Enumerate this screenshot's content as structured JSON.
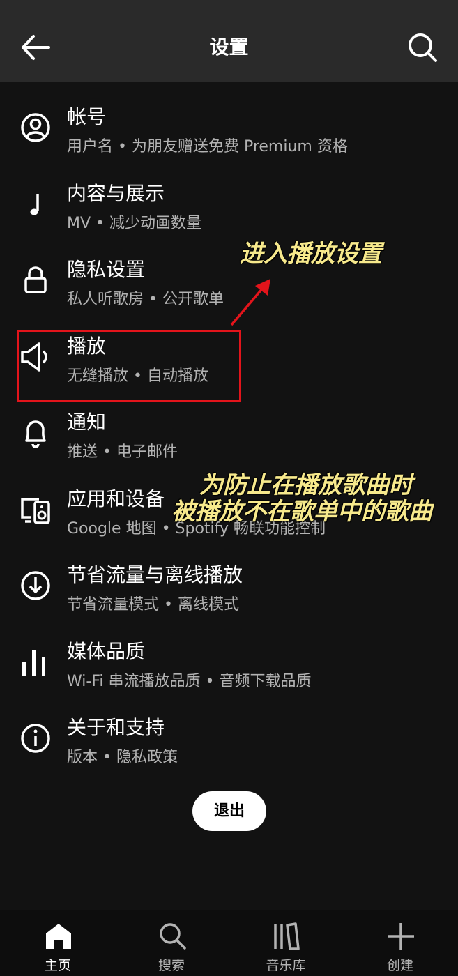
{
  "header": {
    "title": "设置"
  },
  "settings": [
    {
      "title": "帐号",
      "subtitle": "用户名 • 为朋友赠送免费 Premium 资格",
      "icon": "user-circle-icon"
    },
    {
      "title": "内容与展示",
      "subtitle": "MV • 减少动画数量",
      "icon": "music-note-icon"
    },
    {
      "title": "隐私设置",
      "subtitle": "私人听歌房 • 公开歌单",
      "icon": "lock-icon"
    },
    {
      "title": "播放",
      "subtitle": "无缝播放 • 自动播放",
      "icon": "speaker-icon"
    },
    {
      "title": "通知",
      "subtitle": "推送 • 电子邮件",
      "icon": "bell-icon"
    },
    {
      "title": "应用和设备",
      "subtitle": "Google 地图 • Spotify 畅联功能控制",
      "icon": "devices-icon"
    },
    {
      "title": "节省流量与离线播放",
      "subtitle": "节省流量模式 • 离线模式",
      "icon": "download-icon"
    },
    {
      "title": "媒体品质",
      "subtitle": "Wi-Fi 串流播放品质 • 音频下载品质",
      "icon": "bars-icon"
    },
    {
      "title": "关于和支持",
      "subtitle": "版本 • 隐私政策",
      "icon": "info-icon"
    }
  ],
  "logout_label": "退出",
  "annotations": {
    "enter_playback": "进入播放设置",
    "note_line1": "为防止在播放歌曲时",
    "note_line2": "被播放不在歌单中的歌曲"
  },
  "bottom_nav": [
    {
      "label": "主页",
      "icon": "home-icon",
      "active": true
    },
    {
      "label": "搜索",
      "icon": "search-icon",
      "active": false
    },
    {
      "label": "音乐库",
      "icon": "library-icon",
      "active": false
    },
    {
      "label": "创建",
      "icon": "plus-icon",
      "active": false
    }
  ],
  "colors": {
    "background": "#121212",
    "header": "#2a2a2a",
    "highlight": "#e3141b",
    "annotation": "#f7e98c"
  }
}
